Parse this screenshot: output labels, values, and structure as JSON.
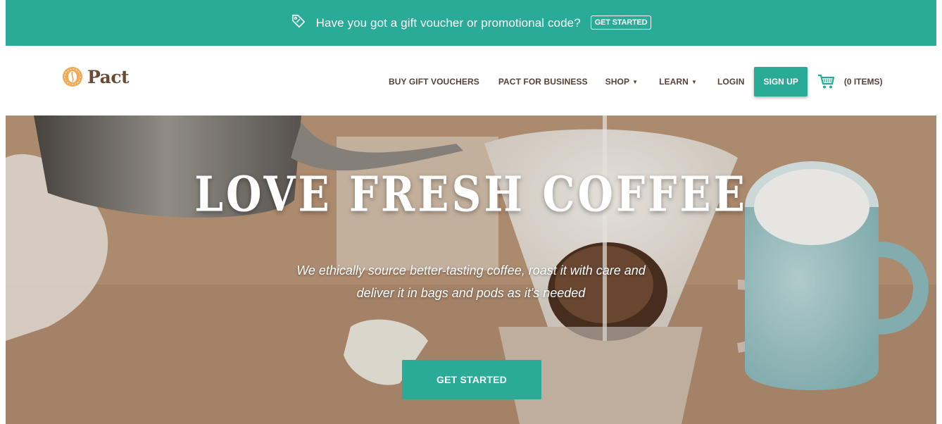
{
  "promo": {
    "text": "Have you got a gift voucher or promotional code?",
    "button_label": "GET STARTED",
    "icon": "tag-icon"
  },
  "header": {
    "logo_text": "Pact",
    "nav": {
      "buy_gift_vouchers": "BUY GIFT VOUCHERS",
      "pact_for_business": "PACT FOR BUSINESS",
      "shop": "SHOP",
      "learn": "LEARN",
      "login": "LOGIN",
      "sign_up": "SIGN UP",
      "cart": "(0 ITEMS)"
    },
    "caret_glyph": "▼"
  },
  "hero": {
    "title": "LOVE FRESH COFFEE",
    "subtitle_line1": "We ethically source better-tasting coffee, roast it with care and",
    "subtitle_line2": "deliver it in bags and pods as it's needed",
    "button_label": "GET STARTED"
  },
  "colors": {
    "brand_teal": "#2aab97",
    "nav_text": "#5a4236",
    "logo_brown": "#6b4a34",
    "logo_orange": "#f0a955"
  }
}
